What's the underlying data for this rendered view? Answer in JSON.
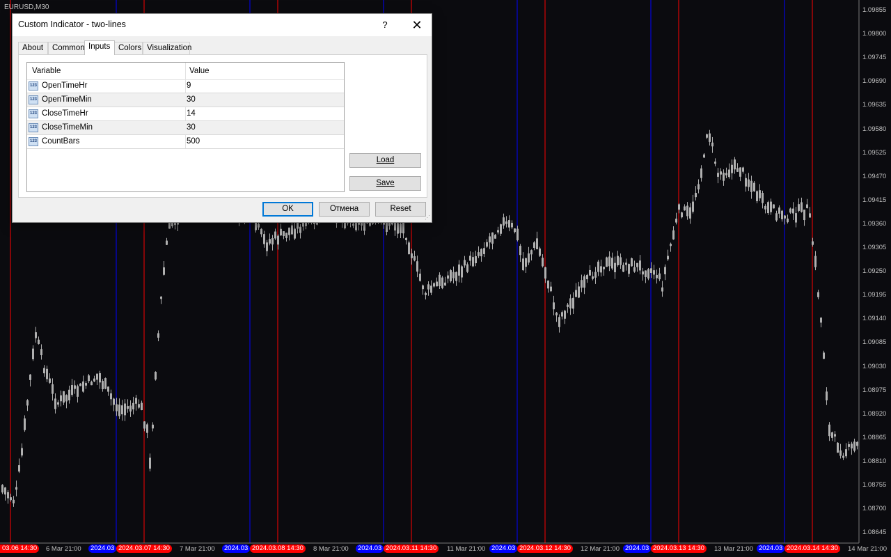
{
  "chart": {
    "symbol": "EURUSD,M30",
    "price_labels": [
      "1.09855",
      "1.09800",
      "1.09745",
      "1.09690",
      "1.09635",
      "1.09580",
      "1.09525",
      "1.09470",
      "1.09415",
      "1.09360",
      "1.09305",
      "1.09250",
      "1.09195",
      "1.09140",
      "1.09085",
      "1.09030",
      "1.08975",
      "1.08920",
      "1.08865",
      "1.08810",
      "1.08755",
      "1.08700",
      "1.08645"
    ],
    "time_labels": [
      "6 Mar 21:00",
      "7 Mar 21:00",
      "8 Mar 21:00",
      "11 Mar 21:00",
      "12 Mar 21:00",
      "13 Mar 21:00",
      "14 Mar 21:00"
    ],
    "open_line_labels": [
      "2024.03",
      "2024.03",
      "2024.03",
      "2024.03",
      "2024.03",
      "2024.03"
    ],
    "close_line_labels": [
      "03.06 14:30",
      "2024.03.07 14:30",
      "2024.03.08 14:30",
      "2024.03.11 14:30",
      "2024.03.12 14:30",
      "2024.03.13 14:30",
      "2024.03.14 14:30"
    ],
    "colors": {
      "background": "#0b0b0f",
      "candle": "#b0b0b0",
      "open_line": "#0000ff",
      "close_line": "#ff0000"
    }
  },
  "dialog": {
    "title": "Custom Indicator - two-lines",
    "help_label": "?",
    "close_label": "✕",
    "tabs": [
      "About",
      "Common",
      "Inputs",
      "Colors",
      "Visualization"
    ],
    "active_tab": "Inputs",
    "columns": {
      "variable": "Variable",
      "value": "Value"
    },
    "inputs": [
      {
        "name": "OpenTimeHr",
        "value": "9"
      },
      {
        "name": "OpenTimeMin",
        "value": "30"
      },
      {
        "name": "CloseTimeHr",
        "value": "14"
      },
      {
        "name": "CloseTimeMin",
        "value": "30"
      },
      {
        "name": "CountBars",
        "value": "500"
      }
    ],
    "type_icon": "123",
    "load_label": "Load",
    "save_label": "Save",
    "ok_label": "OK",
    "cancel_label": "Отмена",
    "reset_label": "Reset"
  }
}
